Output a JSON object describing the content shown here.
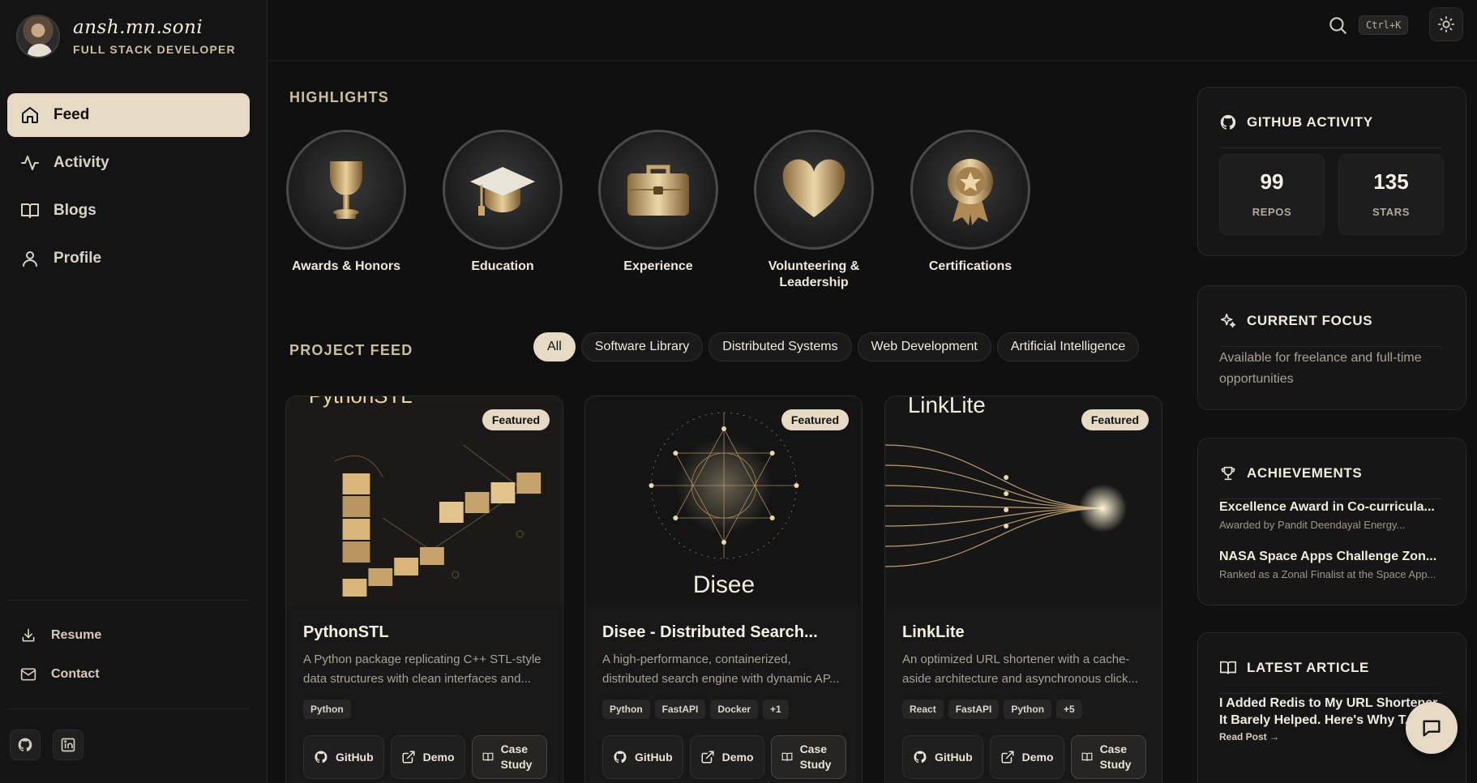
{
  "profile": {
    "name": "ansh.mn.soni",
    "role": "FULL STACK DEVELOPER"
  },
  "nav": [
    {
      "label": "Feed",
      "icon": "home-icon",
      "active": true
    },
    {
      "label": "Activity",
      "icon": "activity-icon"
    },
    {
      "label": "Blogs",
      "icon": "book-icon"
    },
    {
      "label": "Profile",
      "icon": "user-icon"
    }
  ],
  "sidebar_links": {
    "resume": "Resume",
    "contact": "Contact"
  },
  "topbar": {
    "shortcut": "Ctrl+K"
  },
  "highlights": {
    "title": "HIGHLIGHTS",
    "items": [
      {
        "label": "Awards & Honors",
        "icon": "trophy-icon"
      },
      {
        "label": "Education",
        "icon": "graduation-cap-icon"
      },
      {
        "label": "Experience",
        "icon": "briefcase-icon"
      },
      {
        "label": "Volunteering & Leadership",
        "icon": "heart-icon"
      },
      {
        "label": "Certifications",
        "icon": "medal-icon"
      }
    ]
  },
  "project_feed": {
    "title": "PROJECT FEED",
    "filters": [
      "All",
      "Software Library",
      "Distributed Systems",
      "Web Development",
      "Artificial Intelligence"
    ],
    "projects": [
      {
        "title": "PythonSTL",
        "badge": "Featured",
        "image_title": "PythonSTL",
        "description": "A Python package replicating C++ STL-style data structures with clean interfaces and...",
        "tags": [
          "Python"
        ],
        "actions": [
          "GitHub",
          "Demo",
          "Case Study"
        ]
      },
      {
        "title": "Disee - Distributed Search...",
        "badge": "Featured",
        "image_title": "Disee",
        "description": "A high-performance, containerized, distributed search engine with dynamic AP...",
        "tags": [
          "Python",
          "FastAPI",
          "Docker",
          "+1"
        ],
        "actions": [
          "GitHub",
          "Demo",
          "Case Study"
        ]
      },
      {
        "title": "LinkLite",
        "badge": "Featured",
        "image_title": "LinkLite",
        "description": "An optimized URL shortener with a cache-aside architecture and asynchronous click...",
        "tags": [
          "React",
          "FastAPI",
          "Python",
          "+5"
        ],
        "actions": [
          "GitHub",
          "Demo",
          "Case Study"
        ]
      }
    ]
  },
  "github": {
    "title": "GITHUB ACTIVITY",
    "repos": "99",
    "repos_label": "REPOS",
    "stars": "135",
    "stars_label": "STARS"
  },
  "focus": {
    "title": "CURRENT FOCUS",
    "text": "Available for freelance and full-time opportunities"
  },
  "achievements": {
    "title": "ACHIEVEMENTS",
    "items": [
      {
        "title": "Excellence Award in Co-curricula...",
        "sub": "Awarded by Pandit Deendayal Energy..."
      },
      {
        "title": "NASA Space Apps Challenge Zon...",
        "sub": "Ranked as a Zonal Finalist at the Space App..."
      }
    ]
  },
  "article": {
    "title": "LATEST ARTICLE",
    "headline": "I Added Redis to My URL Shortener. It Barely Helped. Here's Why T...",
    "read": "Read Post →"
  },
  "colors": {
    "accent": "#e6dac5",
    "background": "#101010",
    "panel": "#161616",
    "gold": "#c9a56a"
  }
}
